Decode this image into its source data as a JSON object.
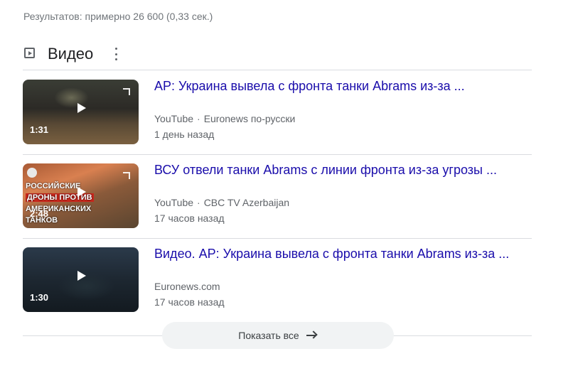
{
  "stats": "Результатов: примерно 26 600 (0,33 сек.)",
  "section": {
    "title": "Видео",
    "icon": "video-play-icon"
  },
  "videos": [
    {
      "title": "AP: Украина вывела с фронта танки Abrams из-за ...",
      "platform": "YouTube",
      "channel": "Euronews по-русски",
      "time": "1 день назад",
      "duration": "1:31"
    },
    {
      "title": "ВСУ отвели танки Abrams с линии фронта из-за угрозы ...",
      "platform": "YouTube",
      "channel": "CBC TV Azerbaijan",
      "time": "17 часов назад",
      "duration": "2:48",
      "thumb_text": {
        "line1": "Российские",
        "line2": "дроны против",
        "line3": "американских",
        "line4": "танков"
      }
    },
    {
      "title": "Видео. AP: Украина вывела с фронта танки Abrams из-за ...",
      "platform": "Euronews.com",
      "time": "17 часов назад",
      "duration": "1:30"
    }
  ],
  "show_all": {
    "label": "Показать все",
    "icon": "arrow-right-icon"
  },
  "colors": {
    "link": "#1a0dab",
    "meta": "#5f6368",
    "divider": "#dadce0",
    "button_bg": "#f1f3f4"
  }
}
